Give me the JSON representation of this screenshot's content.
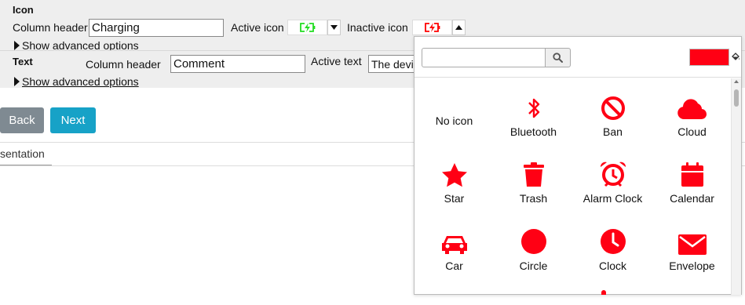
{
  "icon_section": {
    "title": "Icon",
    "column_header_label": "Column header",
    "column_header_value": "Charging",
    "active_icon_label": "Active icon",
    "inactive_icon_label": "Inactive icon",
    "active_icon": "charging-icon",
    "inactive_icon": "charging-icon",
    "active_color": "#22dd22",
    "inactive_color": "#ff0000",
    "advanced_label": "Show advanced options"
  },
  "text_section": {
    "title": "Text",
    "column_header_label": "Column header",
    "column_header_value": "Comment",
    "active_text_label": "Active text",
    "active_text_value": "The devi",
    "advanced_label": "Show advanced options"
  },
  "nav": {
    "back_label": "Back",
    "next_label": "Next",
    "back_color": "#7f8a92",
    "next_color": "#17a2c7"
  },
  "tab_fragment": "sentation",
  "icon_picker": {
    "search_value": "",
    "search_icon": "magnifier-icon",
    "selected_color": "#ff0014",
    "icon_color": "#ff0014",
    "items": [
      {
        "label": "No icon",
        "icon": "none"
      },
      {
        "label": "Bluetooth",
        "icon": "bluetooth-icon"
      },
      {
        "label": "Ban",
        "icon": "ban-icon"
      },
      {
        "label": "Cloud",
        "icon": "cloud-icon"
      },
      {
        "label": "Star",
        "icon": "star-icon"
      },
      {
        "label": "Trash",
        "icon": "trash-icon"
      },
      {
        "label": "Alarm Clock",
        "icon": "alarm-clock-icon"
      },
      {
        "label": "Calendar",
        "icon": "calendar-icon"
      },
      {
        "label": "Car",
        "icon": "car-icon"
      },
      {
        "label": "Circle",
        "icon": "circle-icon"
      },
      {
        "label": "Clock",
        "icon": "clock-icon"
      },
      {
        "label": "Envelope",
        "icon": "envelope-icon"
      }
    ]
  }
}
